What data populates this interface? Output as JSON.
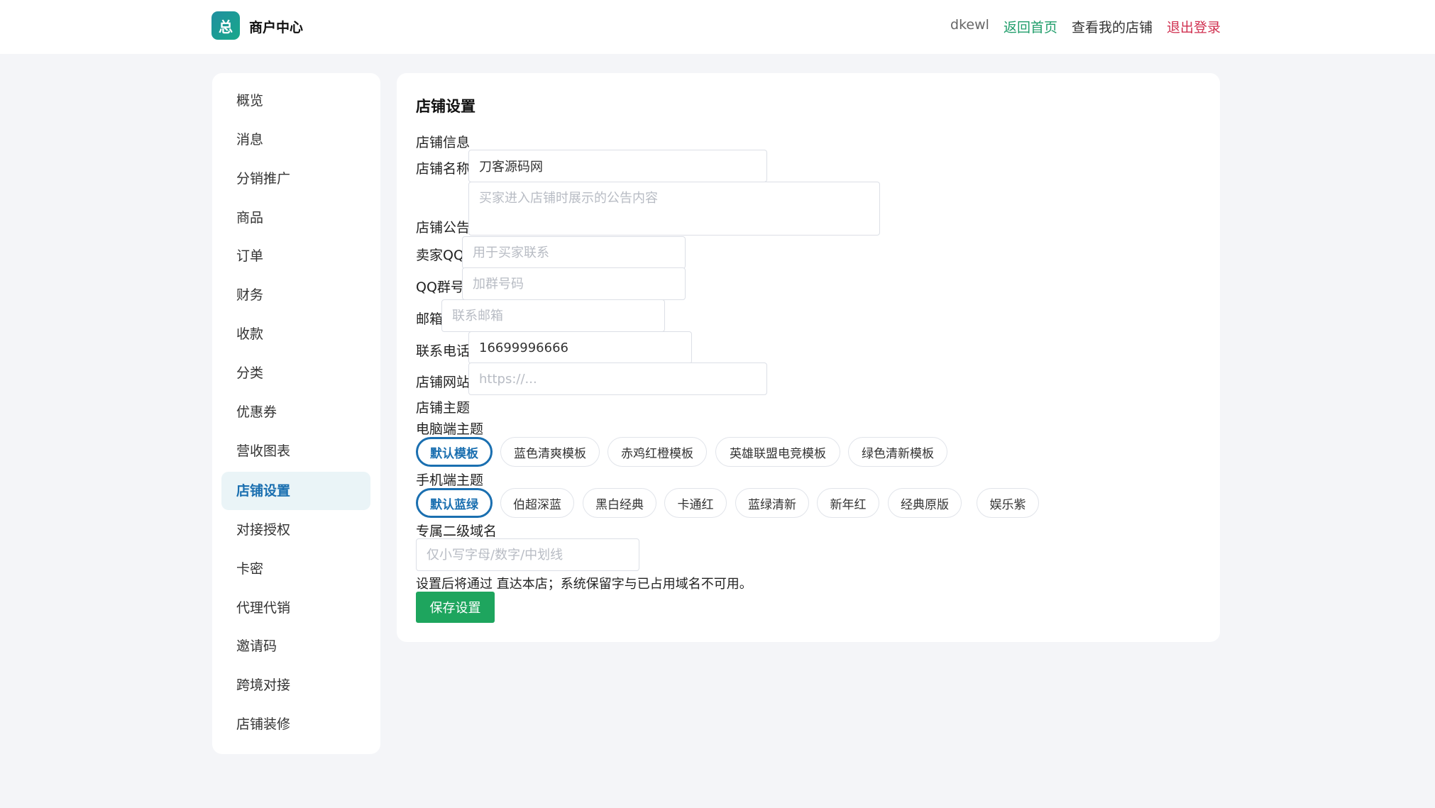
{
  "header": {
    "logo_char": "总",
    "brand": "商户中心",
    "username": "dkewl",
    "home_link": "返回首页",
    "shop_link": "查看我的店铺",
    "logout_link": "退出登录"
  },
  "sidebar": {
    "items": [
      {
        "label": "概览"
      },
      {
        "label": "消息"
      },
      {
        "label": "分销推广"
      },
      {
        "label": "商品"
      },
      {
        "label": "订单"
      },
      {
        "label": "财务"
      },
      {
        "label": "收款"
      },
      {
        "label": "分类"
      },
      {
        "label": "优惠券"
      },
      {
        "label": "营收图表"
      },
      {
        "label": "店铺设置",
        "active": true
      },
      {
        "label": "对接授权"
      },
      {
        "label": "卡密"
      },
      {
        "label": "代理代销"
      },
      {
        "label": "邀请码"
      },
      {
        "label": "跨境对接"
      },
      {
        "label": "店铺装修"
      }
    ]
  },
  "main": {
    "title": "店铺设置",
    "section_info": "店铺信息",
    "shop_name": {
      "label": "店铺名称",
      "value": "刀客源码网"
    },
    "notice": {
      "label": "店铺公告",
      "placeholder": "买家进入店铺时展示的公告内容"
    },
    "qq": {
      "label": "卖家QQ",
      "placeholder": "用于买家联系"
    },
    "qq_group": {
      "label": "QQ群号",
      "placeholder": "加群号码"
    },
    "email": {
      "label": "邮箱",
      "placeholder": "联系邮箱"
    },
    "phone": {
      "label": "联系电话",
      "value": "16699996666"
    },
    "website": {
      "label": "店铺网站",
      "placeholder": "https://..."
    },
    "section_theme": "店铺主题",
    "pc_theme_label": "电脑端主题",
    "pc_themes": [
      "默认模板",
      "蓝色清爽模板",
      "赤鸡红橙模板",
      "英雄联盟电竞模板",
      "绿色清新模板"
    ],
    "pc_theme_selected": "默认模板",
    "mobile_theme_label": "手机端主题",
    "mobile_themes": [
      "默认蓝绿",
      "伯超深蓝",
      "黑白经典",
      "卡通红",
      "蓝绿清新",
      "新年红",
      "经典原版",
      "娱乐紫"
    ],
    "mobile_theme_selected": "默认蓝绿",
    "subdomain_label": "专属二级域名",
    "subdomain_placeholder": "仅小写字母/数字/中划线",
    "subdomain_note": "设置后将通过 直达本店；系统保留字与已占用域名不可用。",
    "save_label": "保存设置"
  },
  "colors": {
    "accent_blue": "#1a6fb0",
    "home_green": "#1f9d6a",
    "logout_red": "#d03050",
    "save_green": "#1ea55e",
    "page_bg": "#f4f5f8"
  }
}
